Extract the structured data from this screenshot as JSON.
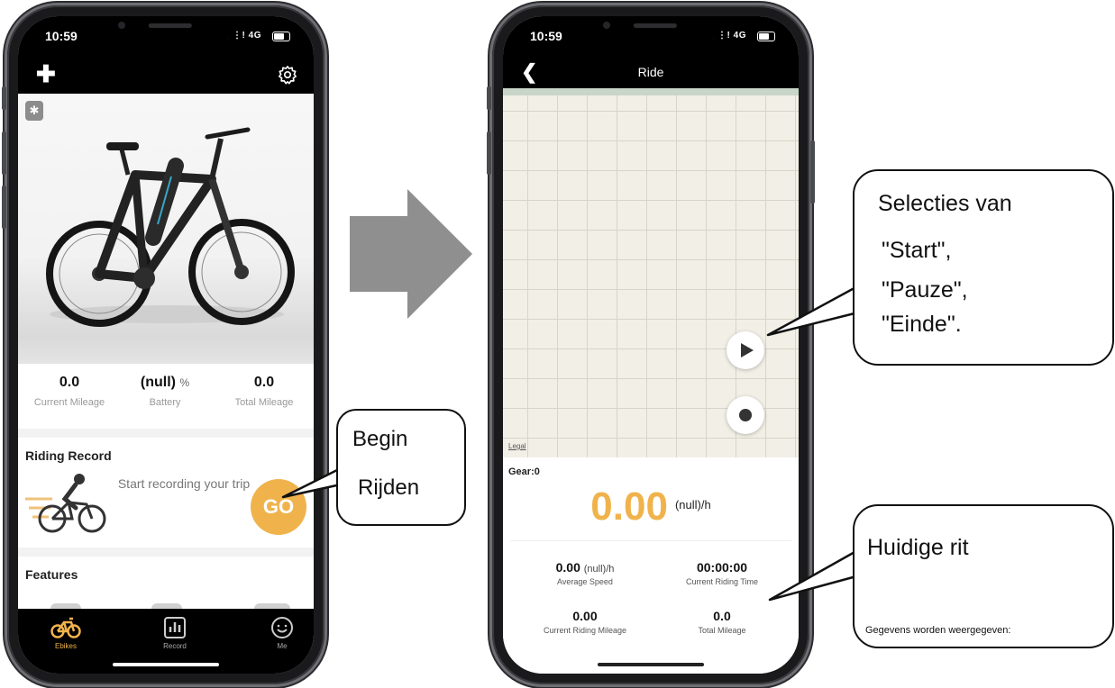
{
  "phone1": {
    "status": {
      "time": "10:59",
      "network": "4G"
    },
    "stats": [
      {
        "value": "0.0",
        "unit": "",
        "label": "Current Mileage"
      },
      {
        "value": "(null)",
        "unit": "%",
        "label": "Battery"
      },
      {
        "value": "0.0",
        "unit": "",
        "label": "Total Mileage"
      }
    ],
    "riding_record": {
      "title": "Riding Record",
      "text": "Start recording your trip",
      "go_label": "GO"
    },
    "features": {
      "title": "Features"
    },
    "tabs": [
      {
        "label": "Ebikes",
        "icon": "bike-icon",
        "active": true
      },
      {
        "label": "Record",
        "icon": "chart-icon",
        "active": false
      },
      {
        "label": "Me",
        "icon": "smiley-icon",
        "active": false
      }
    ],
    "colors": {
      "accent": "#f0b34c"
    }
  },
  "phone2": {
    "status": {
      "time": "10:59",
      "network": "4G"
    },
    "title": "Ride",
    "map": {
      "legal": "Legal"
    },
    "gear": "Gear:0",
    "speed": {
      "value": "0.00",
      "unit": "(null)/h"
    },
    "stats": [
      {
        "value": "0.00",
        "unit": "(null)/h",
        "label": "Average Speed"
      },
      {
        "value": "00:00:00",
        "unit": "",
        "label": "Current Riding Time"
      },
      {
        "value": "0.00",
        "unit": "",
        "label": "Current Riding Mileage"
      },
      {
        "value": "0.0",
        "unit": "",
        "label": "Total Mileage"
      }
    ]
  },
  "callouts": {
    "begin": {
      "line1": "Begin",
      "line2": "Rijden"
    },
    "selection": [
      "Selecties van",
      "\"Start\",",
      "\"Pauze\",",
      "\"Einde\"."
    ],
    "current": {
      "title": "Huidige rit",
      "subtitle": "Gegevens worden weergegeven:"
    }
  }
}
